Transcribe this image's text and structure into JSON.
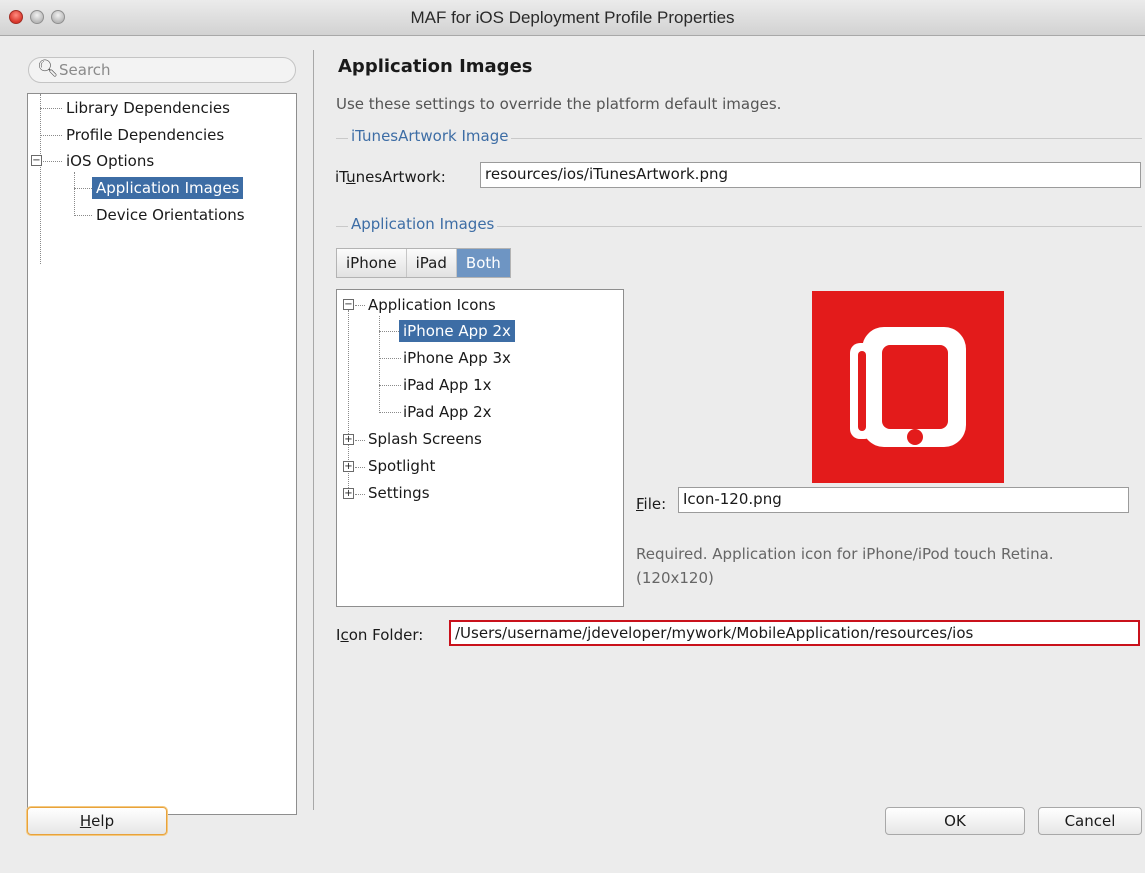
{
  "window": {
    "title": "MAF for iOS Deployment Profile Properties"
  },
  "search": {
    "placeholder": "Search"
  },
  "nav": {
    "items": [
      {
        "label": "Library Dependencies"
      },
      {
        "label": "Profile Dependencies"
      },
      {
        "label": "iOS Options"
      },
      {
        "label": "Application Images"
      },
      {
        "label": "Device Orientations"
      }
    ],
    "selected": "Application Images"
  },
  "panel": {
    "heading": "Application Images",
    "description": "Use these settings to override the platform default images.",
    "itunes_group": "iTunesArtwork Image",
    "itunes_label_pre": "iT",
    "itunes_label_u": "u",
    "itunes_label_post": "nesArtwork:",
    "itunes_value": "resources/ios/iTunesArtwork.png",
    "images_group": "Application Images",
    "segments": [
      "iPhone",
      "iPad",
      "Both"
    ],
    "selected_segment": "Both",
    "tree": {
      "root": "Application Icons",
      "children": [
        "iPhone App 2x",
        "iPhone App 3x",
        "iPad App 1x",
        "iPad App 2x"
      ],
      "selected": "iPhone App 2x",
      "collapsed": [
        "Splash Screens",
        "Spotlight",
        "Settings"
      ]
    },
    "file_label_u": "F",
    "file_label_post": "ile:",
    "file_value": "Icon-120.png",
    "hint_line1": "Required. Application icon for iPhone/iPod touch Retina.",
    "hint_line2": "(120x120)",
    "icon_folder_label_pre": "I",
    "icon_folder_label_u": "c",
    "icon_folder_label_post": "on Folder:",
    "icon_folder_value": "/Users/username/jdeveloper/mywork/MobileApplication/resources/ios"
  },
  "buttons": {
    "help_u": "H",
    "help_post": "elp",
    "ok": "OK",
    "cancel": "Cancel"
  },
  "colors": {
    "selection": "#3d6da5",
    "error_border": "#c9111b",
    "icon_red": "#e31b1b"
  }
}
